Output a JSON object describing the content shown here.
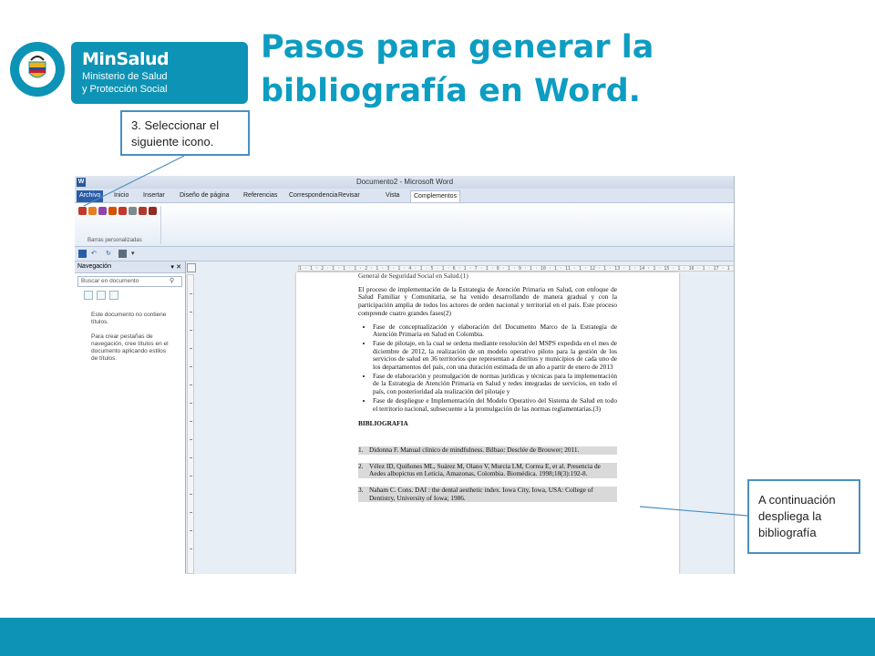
{
  "header": {
    "logo_name": "MinSalud",
    "logo_line1": "Ministerio de Salud",
    "logo_line2": "y Protección Social",
    "seal_text": "REPÚBLICA DE COLOMBIA",
    "title": "Pasos para generar la bibliografía en Word."
  },
  "callouts": {
    "step3": "3. Seleccionar el siguiente icono.",
    "result": "A continuación despliega la bibliografía"
  },
  "word": {
    "app_icon": "W",
    "window_title": "Documento2 - Microsoft Word",
    "tabs": [
      "Archivo",
      "Inicio",
      "Insertar",
      "Diseño de página",
      "Referencias",
      "Correspondencia",
      "Revisar",
      "Vista",
      "Complementos"
    ],
    "active_tab": "Complementos",
    "ribbon_group_label": "Barras personalizadas",
    "nav": {
      "title": "Navegación",
      "search_placeholder": "Buscar en documento",
      "message_1": "Este documento no contiene títulos.",
      "message_2": "Para crear pestañas de navegación, cree títulos en el documento aplicando estilos de títulos."
    },
    "ruler_text": "1 · 1 · 2 · 1 · 1 · 1 · 2 · 1 · 3 · 1 · 4 · 1 · 5 · 1 · 6 · 1 · 7 · 1 · 8 · 1 · 9 · 1 · 10 · 1 · 11 · 1 · 12 · 1 · 13 · 1 · 14 · 1 · 15 · 1 · 16 · 1 · 17 · 1 · 18",
    "doc": {
      "top_line": "General de Seguridad Social en Salud.(1)",
      "paragraph": "El proceso de implementación de la Estrategia de Atención Primaria en Salud, con enfoque de Salud Familiar y Comunitaria, se ha venido desarrollando de manera gradual y con la participación amplia de todos los actores de orden nacional y territorial en el país. Este proceso comprende cuatro grandes fases(2)",
      "bullets": [
        "Fase de conceptualización y elaboración del Documento Marco de la Estrategia de Atención Primaria en Salud en Colombia.",
        "Fase de pilotaje, en la cual se ordena mediante resolución del MSPS expedida en el mes de diciembre de 2012, la realización de un modelo operativo piloto para la gestión de los servicios de salud en 36 territorios que representan a distritos y municipios de cada uno de los departamentos del país, con una duración estimada de un año a partir de enero de 2013",
        "Fase de elaboración y promulgación de normas jurídicas y técnicas para la implementación de la Estrategia de Atención Primaria en Salud y redes integradas de servicios, en todo el país, con posterioridad ala realización del pilotaje y",
        "Fase de despliegue e Implementación del Modelo Operativo del Sistema de Salud en todo el territorio nacional, subsecuente a la promulgación de las normas reglamentarias.(3)"
      ],
      "bib_heading": "BIBLIOGRAFIA",
      "references": [
        {
          "n": "1.",
          "text": "Didonna F. Manual clínico de mindfulness. Bilbao: Desclée de Brouwer; 2011."
        },
        {
          "n": "2.",
          "text": "Vélez ID, Quiñones ML, Suárez M, Olano V, Murcia LM, Correa E, et al. Presencia de Aedes albopictus en Leticia, Amazonas, Colombia. Biomédica. 1998;18(3):192-8."
        },
        {
          "n": "3.",
          "text": "Naham C. Cons. DAI : the dental aesthetic index. Iowa City, Iowa, USA: College of Dentistry, University of Iowa; 1986."
        }
      ]
    }
  },
  "colors": {
    "brand": "#0d93b5",
    "title": "#0d9dc2",
    "callout_border": "#4a8fc0"
  }
}
